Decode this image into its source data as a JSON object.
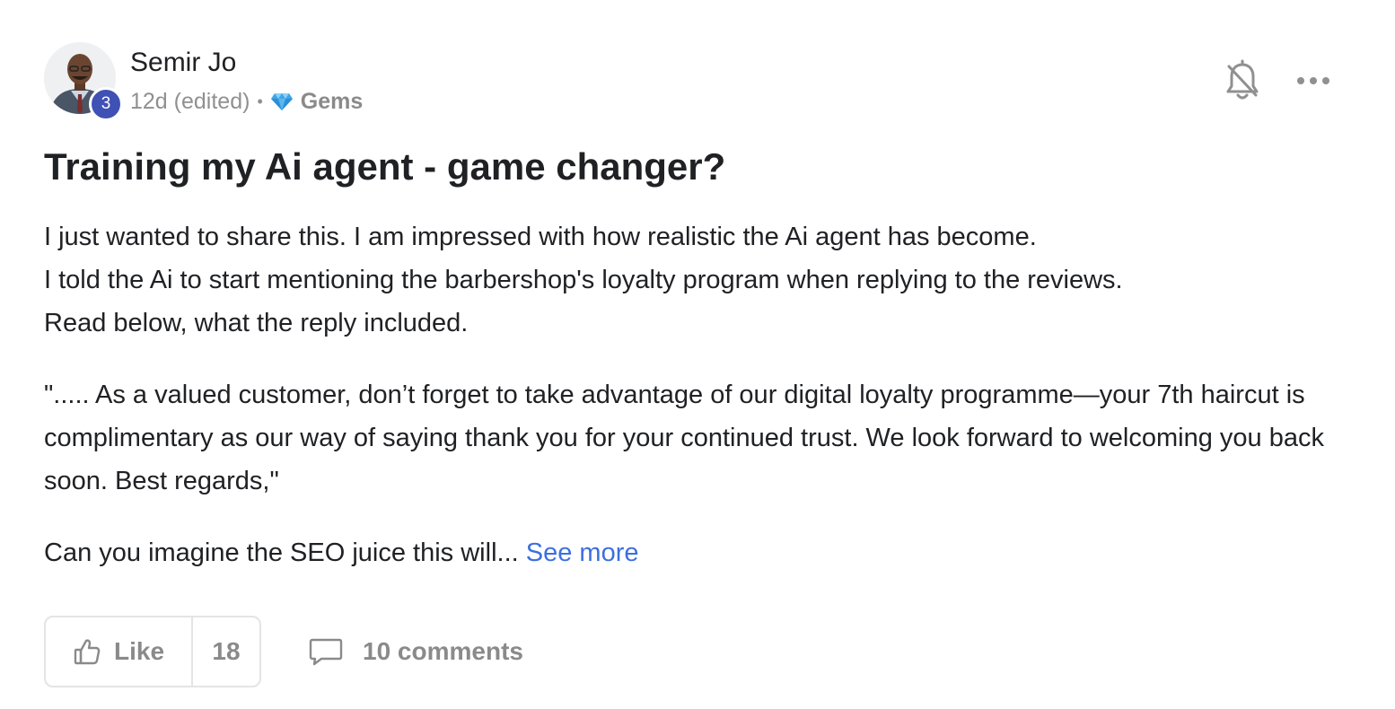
{
  "author": {
    "name": "Semir Jo",
    "level": "3"
  },
  "meta": {
    "time": "12d (edited)",
    "separator": "•",
    "category": "Gems"
  },
  "post": {
    "title": "Training my Ai agent - game changer?",
    "lines": [
      "I just wanted to share this. I am impressed with how realistic the Ai agent has become.",
      "I told the Ai to start mentioning the barbershop's loyalty program when replying to the reviews.",
      "Read below, what the reply included."
    ],
    "quote": "\"..... As a valued customer, don’t forget to take advantage of our digital loyalty programme—your 7th haircut is complimentary as our way of saying thank you for your continued trust. We look forward to welcoming you back soon. Best regards,\"",
    "teaser": "Can you imagine the SEO juice this will... ",
    "see_more": "See more"
  },
  "actions": {
    "like_label": "Like",
    "like_count": "18",
    "comments_label": "10 comments"
  },
  "icons": {
    "bell": "bell-off-icon",
    "more": "more-dots-icon",
    "gem": "gem-icon",
    "like": "thumbs-up-icon",
    "comment": "comment-bubble-icon"
  },
  "colors": {
    "level_badge": "#3f51b5",
    "link": "#3d6fe0",
    "muted": "#8a8a8a",
    "gem": "#3fa6e6"
  }
}
